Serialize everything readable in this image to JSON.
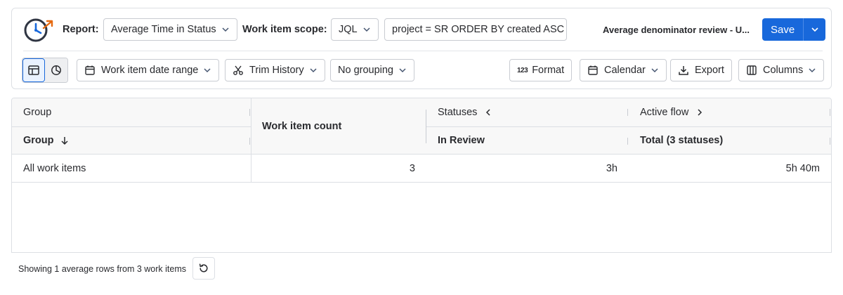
{
  "toolbar": {
    "report_label": "Report:",
    "report_value": "Average Time in Status",
    "scope_label": "Work item scope:",
    "scope_type": "JQL",
    "jql_query": "project = SR ORDER BY created ASC",
    "report_name": "Average denominator review - U...",
    "save_label": "Save",
    "date_range_label": "Work item date range",
    "trim_history_label": "Trim History",
    "grouping_label": "No grouping",
    "format_icon_text": "123",
    "format_label": "Format",
    "calendar_label": "Calendar",
    "export_label": "Export",
    "columns_label": "Columns"
  },
  "table": {
    "headers": {
      "group_top": "Group",
      "group_sub": "Group",
      "work_item_count": "Work item count",
      "statuses": "Statuses",
      "in_review": "In Review",
      "active_flow": "Active flow",
      "total": "Total (3 statuses)"
    },
    "rows": [
      {
        "group": "All work items",
        "count": "3",
        "in_review": "3h",
        "total": "5h 40m"
      }
    ]
  },
  "footer": {
    "summary": "Showing 1 average rows from 3 work items"
  },
  "colors": {
    "accent": "#1868db",
    "border": "#dcdfe4",
    "header_bg": "#f8f8f8",
    "text": "#292a2e"
  }
}
